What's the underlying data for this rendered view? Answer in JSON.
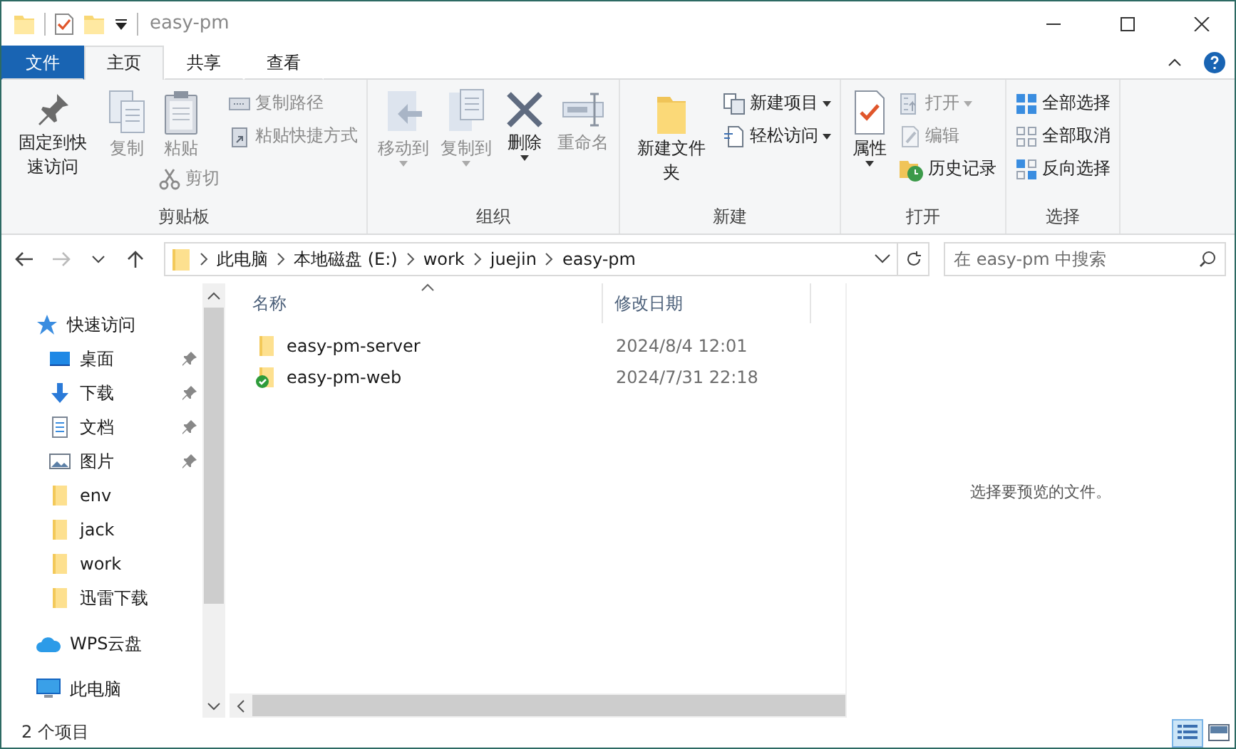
{
  "window": {
    "title": "easy-pm"
  },
  "tabs": [
    {
      "label": "文件",
      "kind": "file",
      "selected": false
    },
    {
      "label": "主页",
      "kind": "tab",
      "selected": true
    },
    {
      "label": "共享",
      "kind": "tab",
      "selected": false
    },
    {
      "label": "查看",
      "kind": "tab",
      "selected": false
    }
  ],
  "ribbon": {
    "groups": [
      {
        "label": "剪贴板",
        "columns": [
          {
            "kind": "large",
            "items": [
              {
                "label": "固定到快速访问",
                "disabled": false,
                "dropdown": false
              }
            ]
          },
          {
            "kind": "large",
            "items": [
              {
                "label": "复制",
                "disabled": true,
                "dropdown": false
              }
            ]
          },
          {
            "kind": "paste",
            "items": [
              {
                "label": "粘贴",
                "disabled": true,
                "dropdown": false
              },
              {
                "label": "剪切",
                "disabled": true,
                "dropdown": false
              }
            ]
          },
          {
            "kind": "stack",
            "items": [
              {
                "label": "复制路径",
                "disabled": true,
                "dropdown": false
              },
              {
                "label": "粘贴快捷方式",
                "disabled": true,
                "dropdown": false
              }
            ]
          }
        ]
      },
      {
        "label": "组织",
        "columns": [
          {
            "kind": "large",
            "items": [
              {
                "label": "移动到",
                "disabled": true,
                "dropdown": true
              }
            ]
          },
          {
            "kind": "large",
            "items": [
              {
                "label": "复制到",
                "disabled": true,
                "dropdown": true
              }
            ]
          },
          {
            "kind": "large",
            "items": [
              {
                "label": "删除",
                "disabled": false,
                "dropdown": true
              }
            ]
          },
          {
            "kind": "large",
            "items": [
              {
                "label": "重命名",
                "disabled": true,
                "dropdown": false
              }
            ]
          }
        ]
      },
      {
        "label": "新建",
        "columns": [
          {
            "kind": "large",
            "items": [
              {
                "label": "新建文件夹",
                "disabled": false,
                "dropdown": false
              }
            ]
          },
          {
            "kind": "stack",
            "items": [
              {
                "label": "新建项目",
                "disabled": false,
                "dropdown": true
              },
              {
                "label": "轻松访问",
                "disabled": false,
                "dropdown": true
              }
            ]
          }
        ]
      },
      {
        "label": "打开",
        "columns": [
          {
            "kind": "large",
            "items": [
              {
                "label": "属性",
                "disabled": false,
                "dropdown": true
              }
            ]
          },
          {
            "kind": "stack",
            "items": [
              {
                "label": "打开",
                "disabled": true,
                "dropdown": true
              },
              {
                "label": "编辑",
                "disabled": true,
                "dropdown": false
              },
              {
                "label": "历史记录",
                "disabled": false,
                "dropdown": false
              }
            ]
          }
        ]
      },
      {
        "label": "选择",
        "columns": [
          {
            "kind": "stack",
            "items": [
              {
                "label": "全部选择",
                "disabled": false,
                "dropdown": false
              },
              {
                "label": "全部取消",
                "disabled": false,
                "dropdown": false
              },
              {
                "label": "反向选择",
                "disabled": false,
                "dropdown": false
              }
            ]
          }
        ]
      }
    ]
  },
  "address": {
    "crumbs": [
      "此电脑",
      "本地磁盘 (E:)",
      "work",
      "juejin",
      "easy-pm"
    ]
  },
  "search": {
    "placeholder": "在 easy-pm 中搜索"
  },
  "sidebar": {
    "items": [
      {
        "label": "快速访问",
        "children": [
          {
            "label": "桌面",
            "pinned": true
          },
          {
            "label": "下载",
            "pinned": true
          },
          {
            "label": "文档",
            "pinned": true
          },
          {
            "label": "图片",
            "pinned": true
          },
          {
            "label": "env",
            "pinned": false
          },
          {
            "label": "jack",
            "pinned": false
          },
          {
            "label": "work",
            "pinned": false
          },
          {
            "label": "迅雷下载",
            "pinned": false
          }
        ]
      },
      {
        "label": "WPS云盘"
      },
      {
        "label": "此电脑"
      }
    ]
  },
  "table": {
    "columns": [
      "名称",
      "修改日期"
    ],
    "rows": [
      {
        "name": "easy-pm-server",
        "modified": "2024/8/4 12:01",
        "synced": false
      },
      {
        "name": "easy-pm-web",
        "modified": "2024/7/31 22:18",
        "synced": true
      }
    ]
  },
  "preview": {
    "message": "选择要预览的文件。"
  },
  "status_bar": {
    "count": "2 个项目",
    "views": [
      {
        "kind": "details",
        "selected": true
      },
      {
        "kind": "large",
        "selected": false
      }
    ]
  }
}
